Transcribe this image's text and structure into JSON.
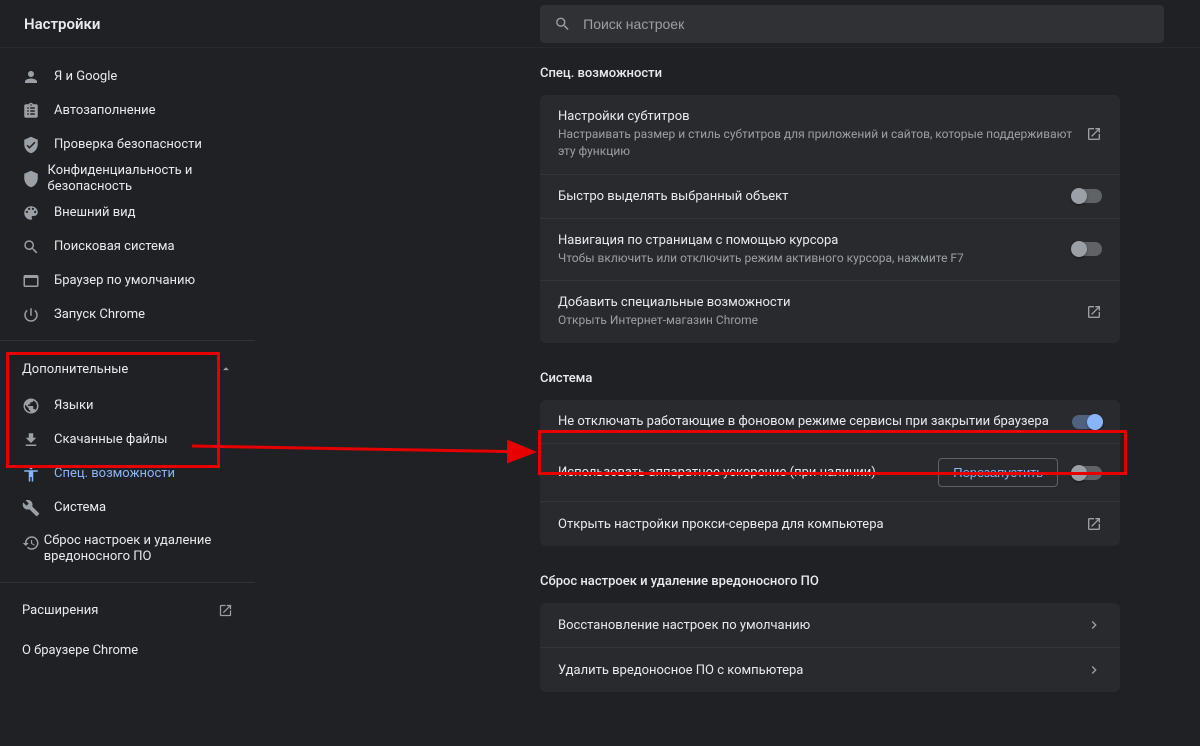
{
  "header": {
    "title": "Настройки",
    "search_placeholder": "Поиск настроек"
  },
  "sidebar": {
    "items": [
      {
        "label": "Я и Google",
        "icon": "person"
      },
      {
        "label": "Автозаполнение",
        "icon": "clipboard"
      },
      {
        "label": "Проверка безопасности",
        "icon": "shield-check"
      },
      {
        "label": "Конфиденциальность и безопасность",
        "icon": "shield"
      },
      {
        "label": "Внешний вид",
        "icon": "palette"
      },
      {
        "label": "Поисковая система",
        "icon": "search"
      },
      {
        "label": "Браузер по умолчанию",
        "icon": "browser"
      },
      {
        "label": "Запуск Chrome",
        "icon": "power"
      }
    ],
    "advanced_label": "Дополнительные",
    "advanced": [
      {
        "label": "Языки",
        "icon": "globe"
      },
      {
        "label": "Скачанные файлы",
        "icon": "download"
      },
      {
        "label": "Спец. возможности",
        "icon": "accessibility",
        "selected": true
      },
      {
        "label": "Система",
        "icon": "wrench"
      },
      {
        "label": "Сброс настроек и удаление вредоносного ПО",
        "icon": "restore"
      }
    ],
    "extensions_label": "Расширения",
    "about_label": "О браузере Chrome"
  },
  "sections": {
    "accessibility": {
      "title": "Спец. возможности",
      "rows": {
        "captions_title": "Настройки субтитров",
        "captions_sub": "Настраивать размер и стиль субтитров для приложений и сайтов, которые поддерживают эту функцию",
        "focus_title": "Быстро выделять выбранный объект",
        "caret_title": "Навигация по страницам с помощью курсора",
        "caret_sub": "Чтобы включить или отключить режим активного курсора, нажмите F7",
        "addons_title": "Добавить специальные возможности",
        "addons_sub": "Открыть Интернет-магазин Chrome"
      }
    },
    "system": {
      "title": "Система",
      "rows": {
        "background_title": "Не отключать работающие в фоновом режиме сервисы при закрытии браузера",
        "hwaccel_title": "Использовать аппаратное ускорение (при наличии)",
        "hwaccel_button": "Перезапустить",
        "proxy_title": "Открыть настройки прокси-сервера для компьютера"
      }
    },
    "reset": {
      "title": "Сброс настроек и удаление вредоносного ПО",
      "rows": {
        "restore_title": "Восстановление настроек по умолчанию",
        "cleanup_title": "Удалить вредоносное ПО с компьютера"
      }
    }
  }
}
